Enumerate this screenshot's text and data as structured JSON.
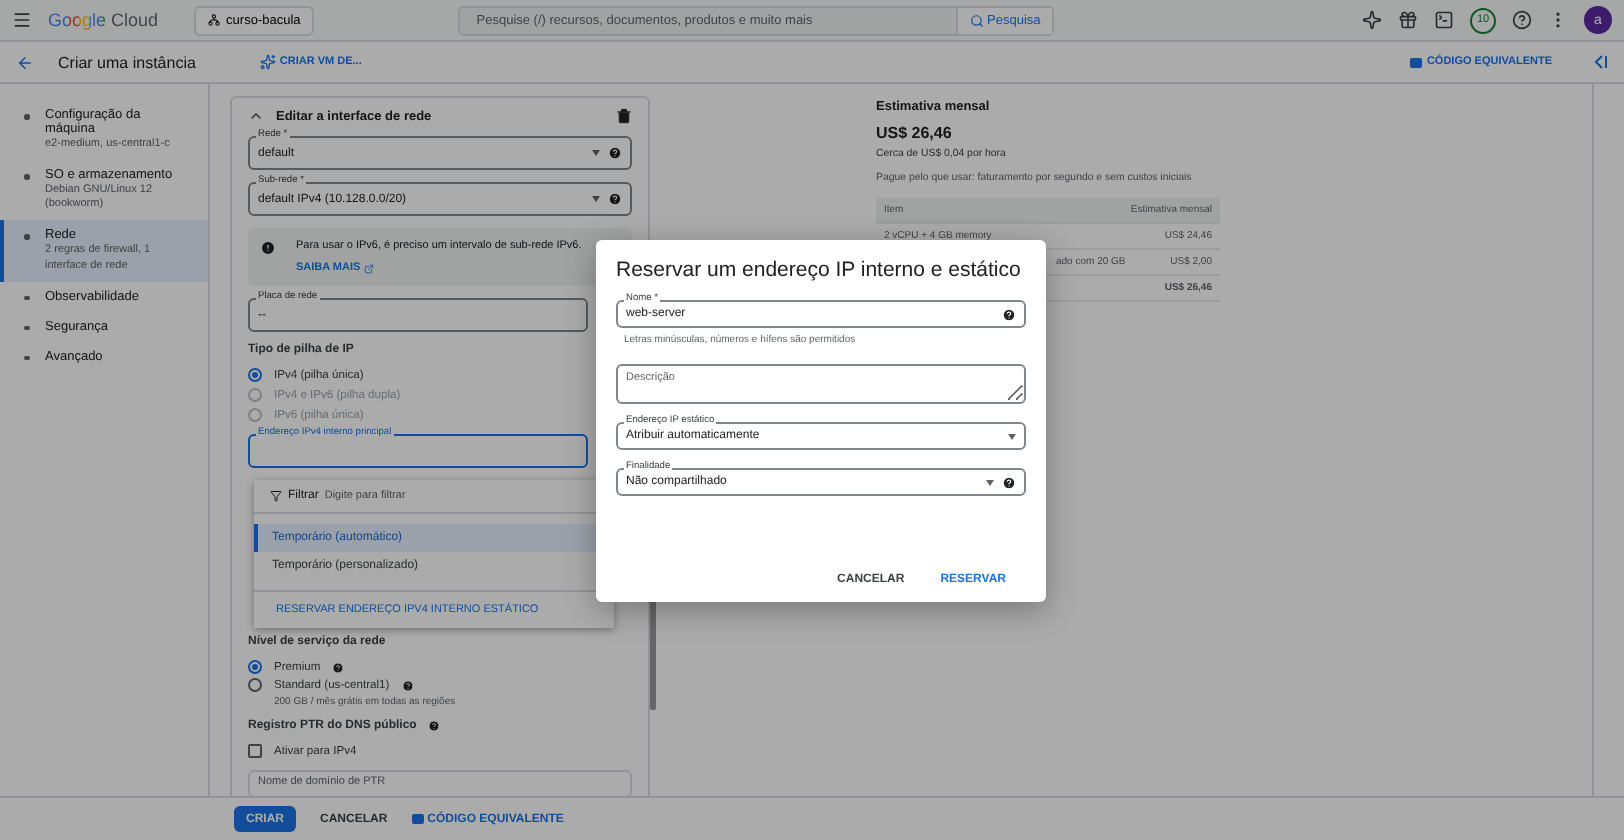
{
  "top_bar": {
    "brand": "Google Cloud",
    "project": "curso-bacula",
    "search": {
      "placeholder": "Pesquise (/) recursos, documentos, produtos e muito mais"
    },
    "search_button": "Pesquisa",
    "badge": "10",
    "avatar": "a"
  },
  "header": {
    "title": "Criar uma instância",
    "create_vm": "CRIAR VM DE...",
    "code": "CÓDIGO EQUIVALENTE"
  },
  "steps": [
    {
      "title": "Configuração da máquina",
      "subtitle": "e2-medium, us-central1-c",
      "selected": false
    },
    {
      "title": "SO e armazenamento",
      "subtitle": "Debian GNU/Linux 12 (bookworm)",
      "selected": false
    },
    {
      "title": "Rede",
      "subtitle": "2 regras de firewall, 1 interface de rede",
      "selected": true
    },
    {
      "title": "Observabilidade",
      "selected": false
    },
    {
      "title": "Segurança",
      "selected": false
    },
    {
      "title": "Avançado",
      "selected": false
    }
  ],
  "section": {
    "title": "Editar a interface de rede",
    "expanded": true
  },
  "selects": [
    {
      "label": "Rede *",
      "value": "default"
    },
    {
      "label": "Sub-rede *",
      "value": "default IPv4 (10.128.0.0/20)"
    }
  ],
  "notice": {
    "text": "Para usar o IPv6, é preciso um intervalo de sub-rede IPv6.",
    "link": "SAIBA MAIS"
  },
  "nic": {
    "label": "Placa de rede",
    "value": "--"
  },
  "ip_stack": {
    "title": "Tipo de pilha de IP",
    "options": [
      {
        "label": "IPv4 (pilha única)",
        "selected": true,
        "disabled": false
      },
      {
        "label": "IPv4 e IPv6 (pilha dupla)",
        "selected": false,
        "disabled": true
      },
      {
        "label": "IPv6 (pilha única)",
        "selected": false,
        "disabled": true
      }
    ]
  },
  "primary_ip": {
    "label": "Endereço IPv4 interno principal"
  },
  "menu": {
    "filter_label": "Filtrar",
    "filter_placeholder": "Digite para filtrar",
    "options": [
      {
        "label": "Temporário (automático)",
        "selected": true
      },
      {
        "label": "Temporário (personalizado)",
        "selected": false
      }
    ],
    "action": "RESERVAR ENDEREÇO IPV4 INTERNO ESTÁTICO"
  },
  "tier": {
    "title": "Nível de serviço da rede",
    "options": [
      {
        "label": "Premium",
        "selected": true
      },
      {
        "label": "Standard (us-central1)",
        "selected": false,
        "note": "200 GB / mês grátis em todas as regiões"
      }
    ]
  },
  "ptr": {
    "title": "Registro PTR do DNS público",
    "checkbox": {
      "label": "Ativar para IPv4",
      "checked": false
    },
    "placeholder": "Nome de domínio de PTR"
  },
  "footer": {
    "create": "CRIAR",
    "cancel": "CANCELAR",
    "code": "CÓDIGO EQUIVALENTE"
  },
  "estimate": {
    "title": "Estimativa mensal",
    "total": "US$ 26,46",
    "hourly": "Cerca de US$ 0,04 por hora",
    "note": "Pague pelo que usar: faturamento por segundo e sem custos iniciais",
    "columns": [
      "Item",
      "Estimativa mensal"
    ],
    "rows": [
      {
        "item": "2 vCPU + 4 GB memory",
        "cost": "US$ 24,46",
        "total": false
      },
      {
        "item": "ado com 20 GB",
        "cost": "US$ 2,00",
        "total": false
      },
      {
        "cost": "US$ 26,46",
        "total": true
      }
    ]
  },
  "dialog": {
    "title": "Reservar um endereço IP interno e estático",
    "name": {
      "label": "Nome *",
      "value": "web-server",
      "hint": "Letras minúsculas, números e hífens são permitidos"
    },
    "description": {
      "placeholder": "Descrição"
    },
    "static_ip": {
      "label": "Endereço IP estático",
      "value": "Atribuir automaticamente"
    },
    "purpose": {
      "label": "Finalidade",
      "value": "Não compartilhado"
    },
    "buttons": [
      "CANCELAR",
      "RESERVAR"
    ]
  }
}
